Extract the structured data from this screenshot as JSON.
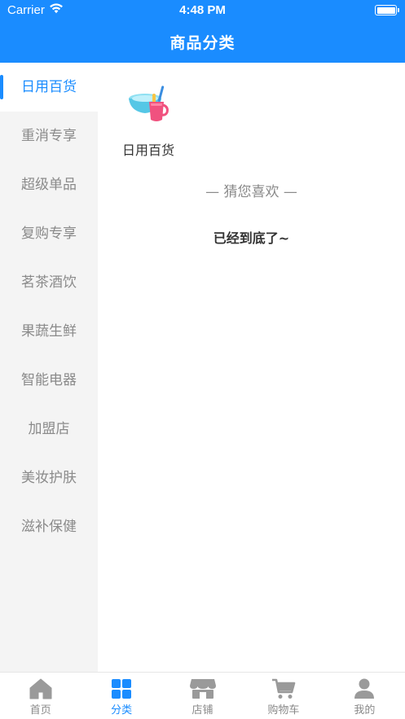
{
  "status_bar": {
    "carrier": "Carrier",
    "time": "4:48 PM"
  },
  "header": {
    "title": "商品分类"
  },
  "sidebar": {
    "items": [
      {
        "label": "日用百货",
        "active": true
      },
      {
        "label": "重消专享"
      },
      {
        "label": "超级单品"
      },
      {
        "label": "复购专享"
      },
      {
        "label": "茗茶酒饮"
      },
      {
        "label": "果蔬生鲜"
      },
      {
        "label": "智能电器"
      },
      {
        "label": "加盟店"
      },
      {
        "label": "美妆护肤"
      },
      {
        "label": "滋补保健"
      }
    ]
  },
  "content": {
    "categories": [
      {
        "label": "日用百货",
        "icon": "basin-cup-icon"
      }
    ],
    "guess_label": "— 猜您喜欢 —",
    "end_label": "已经到底了~"
  },
  "tabbar": {
    "items": [
      {
        "label": "首页",
        "icon": "home-icon"
      },
      {
        "label": "分类",
        "icon": "category-icon",
        "active": true
      },
      {
        "label": "店铺",
        "icon": "store-icon"
      },
      {
        "label": "购物车",
        "icon": "cart-icon"
      },
      {
        "label": "我的",
        "icon": "user-icon"
      }
    ]
  },
  "colors": {
    "primary": "#1a8cff",
    "sidebar_bg": "#f4f4f4",
    "inactive_text": "#8a8a8a",
    "tab_icon_inactive": "#9a9a9a"
  }
}
